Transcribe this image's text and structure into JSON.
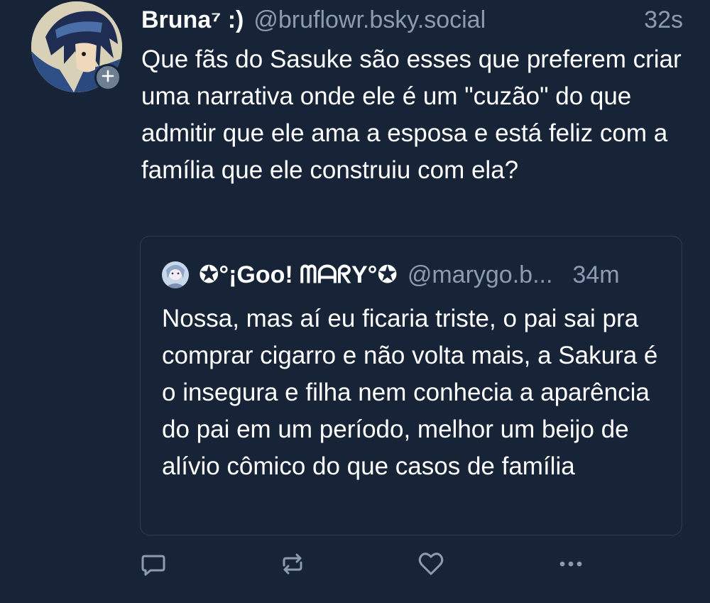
{
  "post": {
    "author": {
      "display_name": "Bruna⁷ :)",
      "handle": "@bruflowr.bsky.social",
      "avatar_icon": "avatar-sasuke"
    },
    "time": "32s",
    "text": "Que fãs do Sasuke são esses que preferem criar uma narrativa onde ele é um \"cuzão\" do que admitir que ele ama a esposa e está feliz com a família que ele construiu com ela?",
    "follow_icon": "plus-icon"
  },
  "quote": {
    "author": {
      "display_name": "✪°¡Goo! ᗰᗩᖇY°✪",
      "handle": "@marygo.b...",
      "avatar_icon": "avatar-mary"
    },
    "time": "34m",
    "text": "Nossa, mas aí eu ficaria triste, o pai sai pra comprar cigarro e não volta mais, a Sakura é o insegura e filha nem conhecia a aparência do pai em um período, melhor um beijo de alívio cômico do que casos de família"
  },
  "actions": [
    {
      "name": "reply",
      "icon": "reply-icon"
    },
    {
      "name": "repost",
      "icon": "repost-icon"
    },
    {
      "name": "like",
      "icon": "heart-icon"
    },
    {
      "name": "more",
      "icon": "more-icon"
    }
  ],
  "colors": {
    "background": "#172437",
    "text": "#ffffff",
    "muted": "#8c9bb0",
    "border": "#2c3d53"
  }
}
